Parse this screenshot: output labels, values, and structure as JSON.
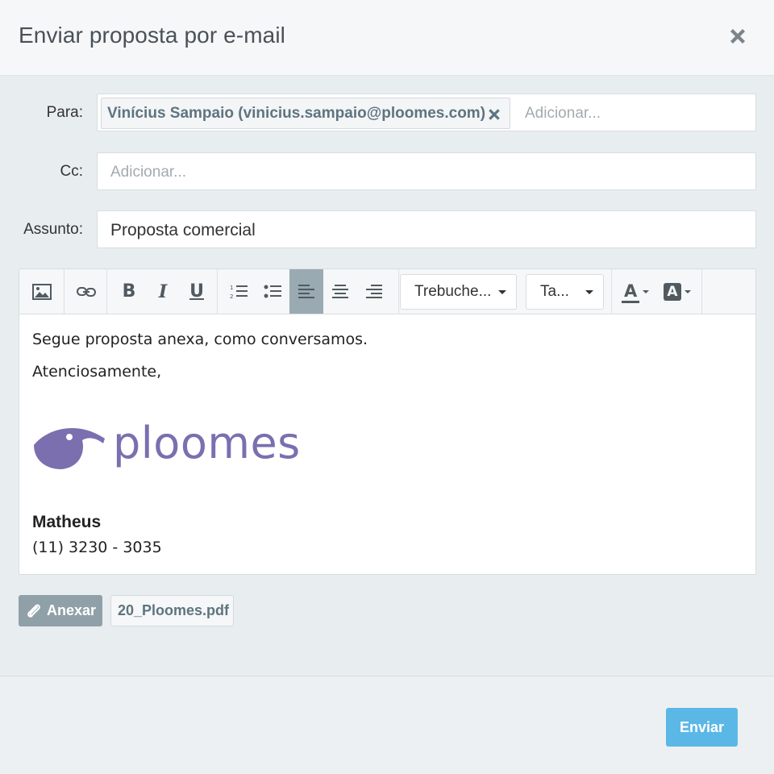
{
  "dialog": {
    "title": "Enviar proposta por e-mail"
  },
  "form": {
    "to_label": "Para:",
    "to_chip": "Vinícius Sampaio (vinicius.sampaio@ploomes.com)",
    "to_placeholder": "Adicionar...",
    "cc_label": "Cc:",
    "cc_placeholder": "Adicionar...",
    "subject_label": "Assunto:",
    "subject_value": "Proposta comercial"
  },
  "toolbar": {
    "bold": "B",
    "italic": "I",
    "underline": "U",
    "font_family": "Trebuche...",
    "font_size": "Ta...",
    "font_color_letter": "A",
    "highlight_letter": "A"
  },
  "body": {
    "line1": "Segue proposta anexa, como conversamos.",
    "line2": "Atenciosamente,",
    "logo_text": "ploomes",
    "signature_name": "Matheus",
    "signature_phone": "(11) 3230 - 3035"
  },
  "attachments": {
    "attach_label": "Anexar",
    "file_name": "20_Ploomes.pdf"
  },
  "footer": {
    "send_label": "Enviar"
  },
  "colors": {
    "accent": "#5bb8e6",
    "logo": "#7b6fb0",
    "chip_text": "#5e7480"
  }
}
